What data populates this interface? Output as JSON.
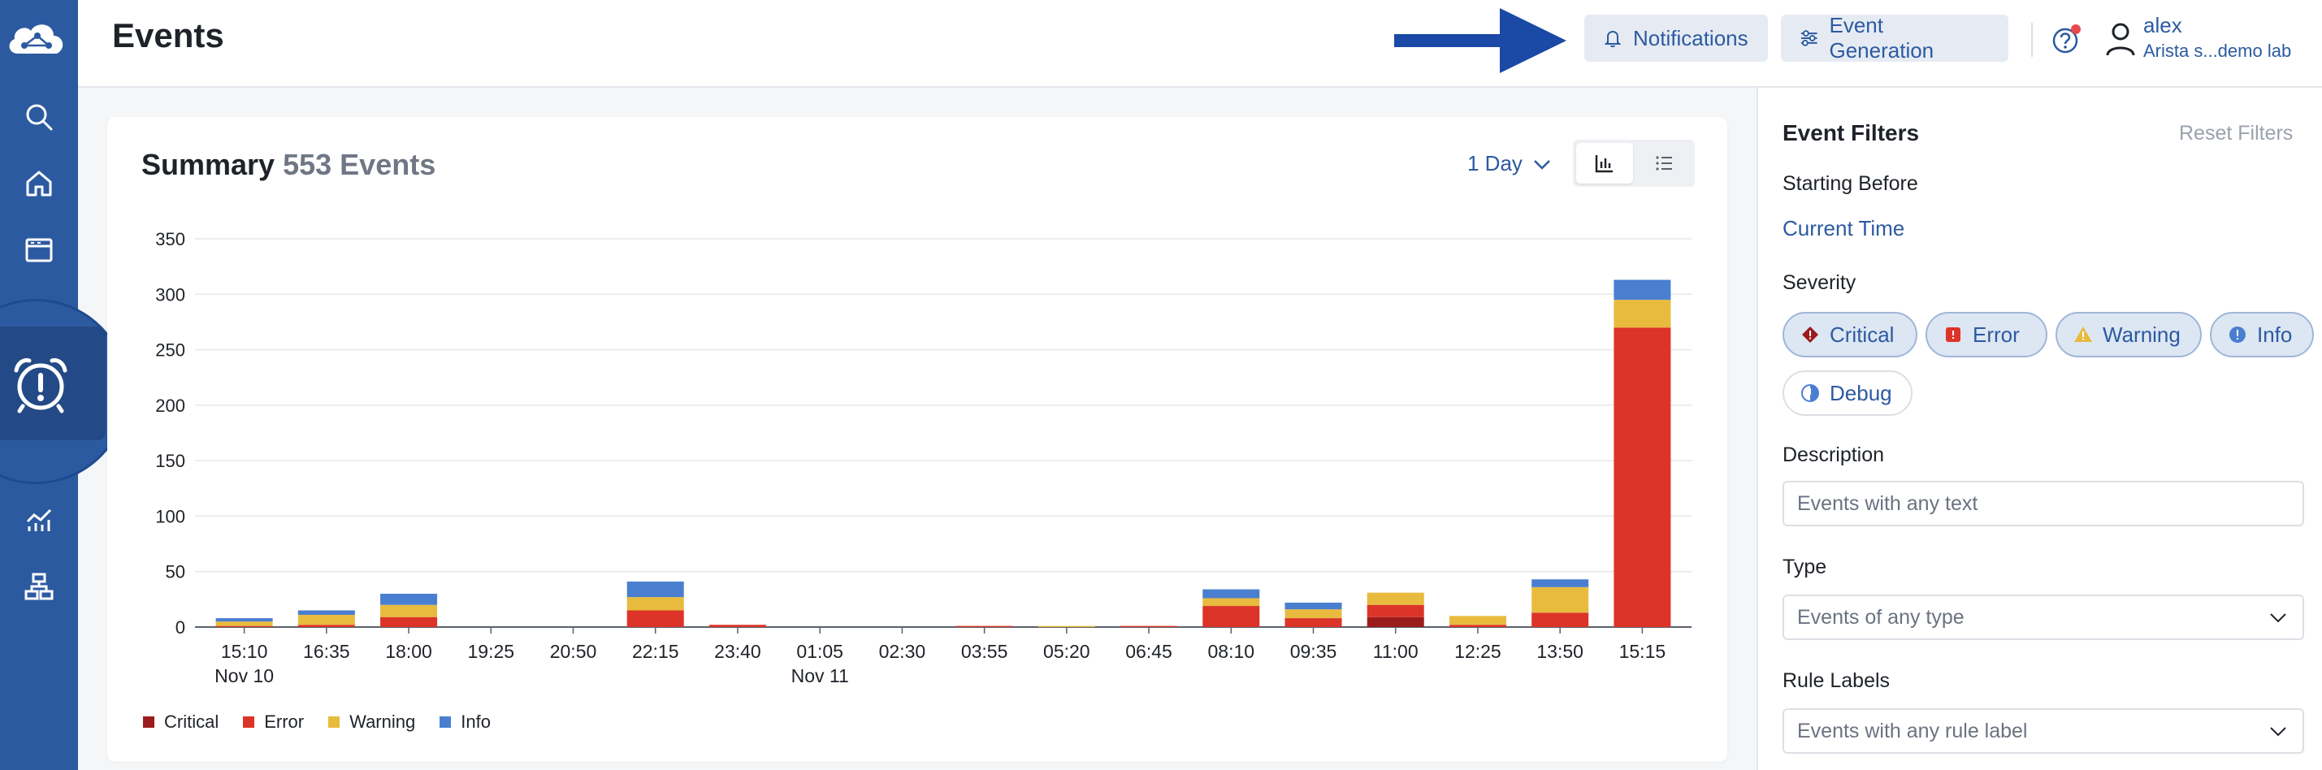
{
  "header": {
    "title": "Events",
    "notifications_label": "Notifications",
    "event_generation_label": "Event Generation",
    "user_name": "alex",
    "user_org": "Arista s...demo lab"
  },
  "summary": {
    "title": "Summary",
    "count": "553 Events",
    "range": "1 Day"
  },
  "colors": {
    "accent": "#2c5aa0",
    "critical": "#9b1c1c",
    "error": "#dc3428",
    "warning": "#e8bb3f",
    "info": "#4a7fcf"
  },
  "chart_data": {
    "type": "bar",
    "stacked": true,
    "categories": [
      "15:10",
      "16:35",
      "18:00",
      "19:25",
      "20:50",
      "22:15",
      "23:40",
      "01:05",
      "02:30",
      "03:55",
      "05:20",
      "06:45",
      "08:10",
      "09:35",
      "11:00",
      "12:25",
      "13:50",
      "15:15"
    ],
    "date_labels": [
      "Nov 10",
      "",
      "",
      "",
      "",
      "",
      "",
      "Nov 11",
      "",
      "",
      "",
      "",
      "",
      "",
      "",
      "",
      "",
      ""
    ],
    "series": [
      {
        "name": "Critical",
        "values": [
          0,
          0,
          0,
          0,
          0,
          0,
          0,
          0,
          0,
          0,
          0,
          0,
          0,
          0,
          9,
          0,
          0,
          0
        ]
      },
      {
        "name": "Error",
        "values": [
          1,
          2,
          9,
          0,
          0,
          15,
          2,
          0,
          0,
          1,
          0,
          1,
          19,
          8,
          11,
          2,
          13,
          270
        ]
      },
      {
        "name": "Warning",
        "values": [
          4,
          9,
          11,
          0,
          0,
          12,
          0,
          0,
          0,
          0,
          1,
          0,
          7,
          8,
          11,
          8,
          23,
          25
        ]
      },
      {
        "name": "Info",
        "values": [
          3,
          4,
          10,
          0,
          0,
          14,
          0,
          0,
          0,
          0,
          0,
          0,
          8,
          6,
          0,
          0,
          7,
          18
        ]
      }
    ],
    "yticks": [
      0,
      50,
      100,
      150,
      200,
      250,
      300,
      350
    ],
    "ylim": [
      0,
      350
    ],
    "grid": true,
    "legend": "bottom-left"
  },
  "filters": {
    "title": "Event Filters",
    "reset": "Reset Filters",
    "starting_label": "Starting Before",
    "starting_value": "Current Time",
    "severity_label": "Severity",
    "severity_chips": [
      "Critical",
      "Error",
      "Warning",
      "Info",
      "Debug"
    ],
    "description_label": "Description",
    "description_placeholder": "Events with any text",
    "type_label": "Type",
    "type_value": "Events of any type",
    "rule_labels_label": "Rule Labels",
    "rule_labels_value": "Events with any rule label"
  }
}
